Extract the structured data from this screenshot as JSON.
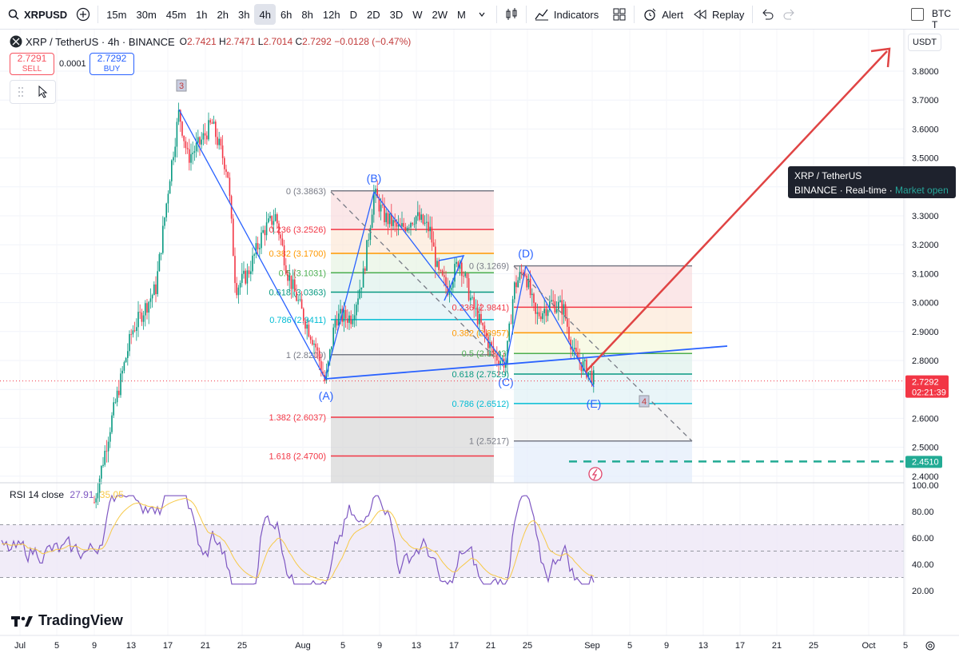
{
  "toolbar": {
    "symbol": "XRPUSD",
    "intervals": [
      "15m",
      "30m",
      "45m",
      "1h",
      "2h",
      "3h",
      "4h",
      "6h",
      "8h",
      "12h",
      "D",
      "2D",
      "3D",
      "W",
      "2W",
      "M"
    ],
    "active_interval": "4h",
    "indicators_label": "Indicators",
    "alert_label": "Alert",
    "replay_label": "Replay",
    "compare_label": "BTC T"
  },
  "legend": {
    "title": "XRP / TetherUS · 4h · BINANCE",
    "o_label": "O",
    "o": "2.7421",
    "h_label": "H",
    "h": "2.7471",
    "l_label": "L",
    "l": "2.7014",
    "c_label": "C",
    "c": "2.7292",
    "change": "−0.0128 (−0.47%)"
  },
  "trade": {
    "sell_price": "2.7291",
    "sell_label": "SELL",
    "spread": "0.0001",
    "buy_price": "2.7292",
    "buy_label": "BUY"
  },
  "currency": "USDT",
  "tooltip": {
    "title": "XRP / TetherUS",
    "exchange": "BINANCE",
    "feed": "Real-time",
    "status": "Market open"
  },
  "price_axis": {
    "ticks": [
      "3.8000",
      "3.7000",
      "3.6000",
      "3.5000",
      "3.4000",
      "3.3000",
      "3.2000",
      "3.1000",
      "3.0000",
      "2.9000",
      "2.8000",
      "2.7000",
      "2.6000",
      "2.5000",
      "2.4000"
    ],
    "last_price": "2.7292",
    "countdown": "02:21:39",
    "target_price": "2.4510"
  },
  "time_axis": {
    "labels": [
      "Jul",
      "5",
      "9",
      "13",
      "17",
      "21",
      "25",
      "Aug",
      "5",
      "9",
      "13",
      "17",
      "21",
      "25",
      "Sep",
      "5",
      "9",
      "13",
      "17",
      "21",
      "25",
      "Oct",
      "5"
    ]
  },
  "wave_labels": {
    "w3": "3",
    "A": "(A)",
    "B": "(B)",
    "C": "(C)",
    "D": "(D)",
    "E": "(E)",
    "w4": "4"
  },
  "fib1": {
    "levels": [
      {
        "label": "0 (3.3863)",
        "color": "#787b86"
      },
      {
        "label": "0.236 (3.2526)",
        "color": "#f23645"
      },
      {
        "label": "0.382 (3.1700)",
        "color": "#ff9800"
      },
      {
        "label": "0.5 (3.1031)",
        "color": "#4caf50"
      },
      {
        "label": "0.618 (3.0363)",
        "color": "#089981"
      },
      {
        "label": "0.786 (2.9411)",
        "color": "#00bcd4"
      },
      {
        "label": "1 (2.8200)",
        "color": "#787b86"
      },
      {
        "label": "1.382 (2.6037)",
        "color": "#f23645"
      },
      {
        "label": "1.618 (2.4700)",
        "color": "#f23645"
      }
    ]
  },
  "fib2": {
    "levels": [
      {
        "label": "0 (3.1269)",
        "color": "#787b86"
      },
      {
        "label": "0.236 (2.9841)",
        "color": "#f23645"
      },
      {
        "label": "0.382 (2.8957)",
        "color": "#ff9800"
      },
      {
        "label": "0.5 (2.8243)",
        "color": "#4caf50"
      },
      {
        "label": "0.618 (2.7529)",
        "color": "#089981"
      },
      {
        "label": "0.786 (2.6512)",
        "color": "#00bcd4"
      },
      {
        "label": "1 (2.5217)",
        "color": "#787b86"
      }
    ]
  },
  "rsi": {
    "label": "RSI 14 close",
    "value": "27.91",
    "ma": "35.05",
    "ticks": [
      "100.00",
      "80.00",
      "60.00",
      "40.00",
      "20.00"
    ]
  },
  "brand": "TradingView",
  "colors": {
    "up": "#089981",
    "down": "#f23645",
    "accent": "#2962ff",
    "rsi": "#7e57c2"
  }
}
